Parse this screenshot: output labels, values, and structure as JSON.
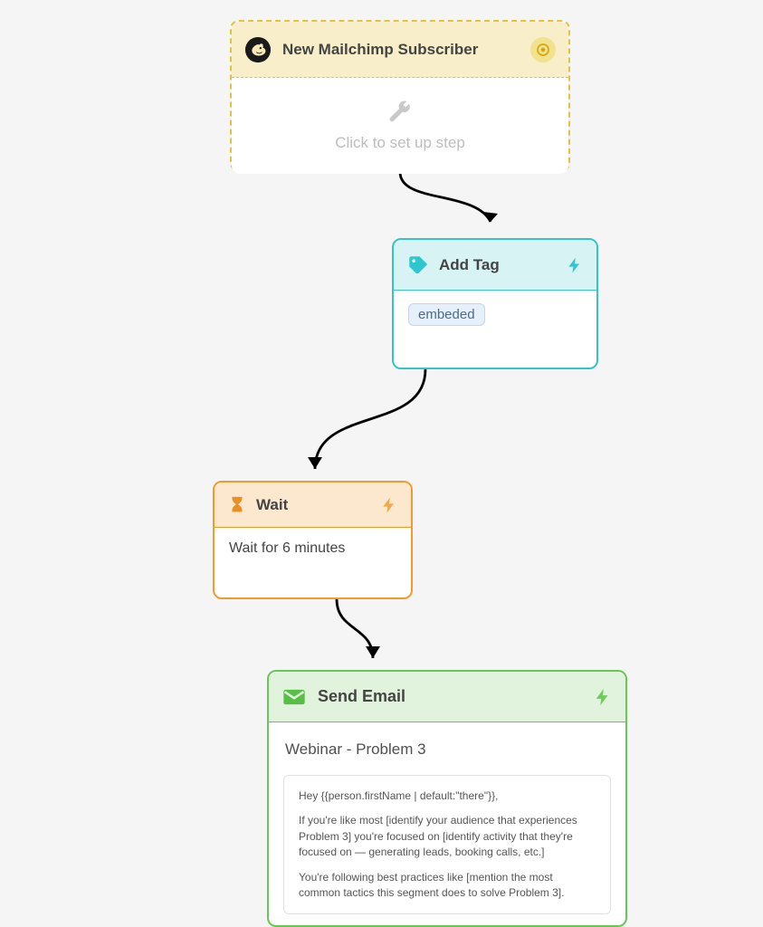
{
  "trigger": {
    "title": "New Mailchimp Subscriber",
    "placeholder": "Click to set up step"
  },
  "addTag": {
    "title": "Add Tag",
    "tag": "embeded"
  },
  "wait": {
    "title": "Wait",
    "description": "Wait for 6 minutes"
  },
  "sendEmail": {
    "title": "Send Email",
    "subject": "Webinar - Problem 3",
    "body_line1": "Hey {{person.firstName | default:\"there\"}},",
    "body_line2": "If you're like most [identify your audience that experiences Problem 3] you're focused on [identify activity that they're focused on — generating leads, booking calls, etc.]",
    "body_line3": "You're following best practices like [mention the most common tactics this segment does to solve Problem 3]."
  }
}
